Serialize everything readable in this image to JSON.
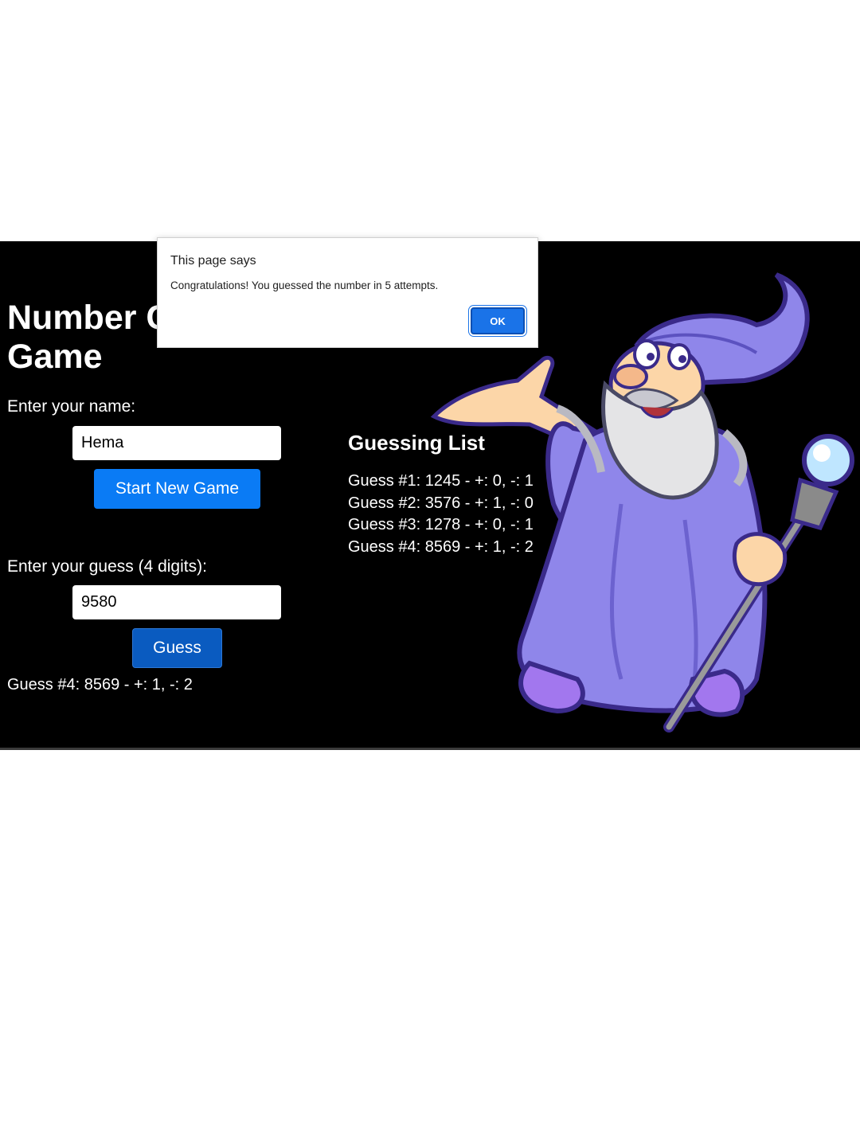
{
  "game": {
    "title": "Number Guessing Game",
    "name_label": "Enter your name:",
    "name_value": "Hema",
    "start_button": "Start New Game",
    "guess_label": "Enter your guess (4 digits):",
    "guess_value": "9580",
    "guess_button": "Guess",
    "last_guess": "Guess #4: 8569 - +: 1, -: 2"
  },
  "guess_list": {
    "title": "Guessing List",
    "items": [
      "Guess #1: 1245 - +: 0, -: 1",
      "Guess #2: 3576 - +: 1, -: 0",
      "Guess #3: 1278 - +: 0, -: 1",
      "Guess #4: 8569 - +: 1, -: 2"
    ]
  },
  "dialog": {
    "title": "This page says",
    "message": "Congratulations! You guessed the number in 5 attempts.",
    "ok_label": "OK"
  },
  "colors": {
    "background": "#000000",
    "primary_button": "#0a7bf5",
    "guess_button": "#0a5bc0",
    "dialog_ok": "#1a73e8",
    "wizard_robe": "#8f86ea"
  }
}
